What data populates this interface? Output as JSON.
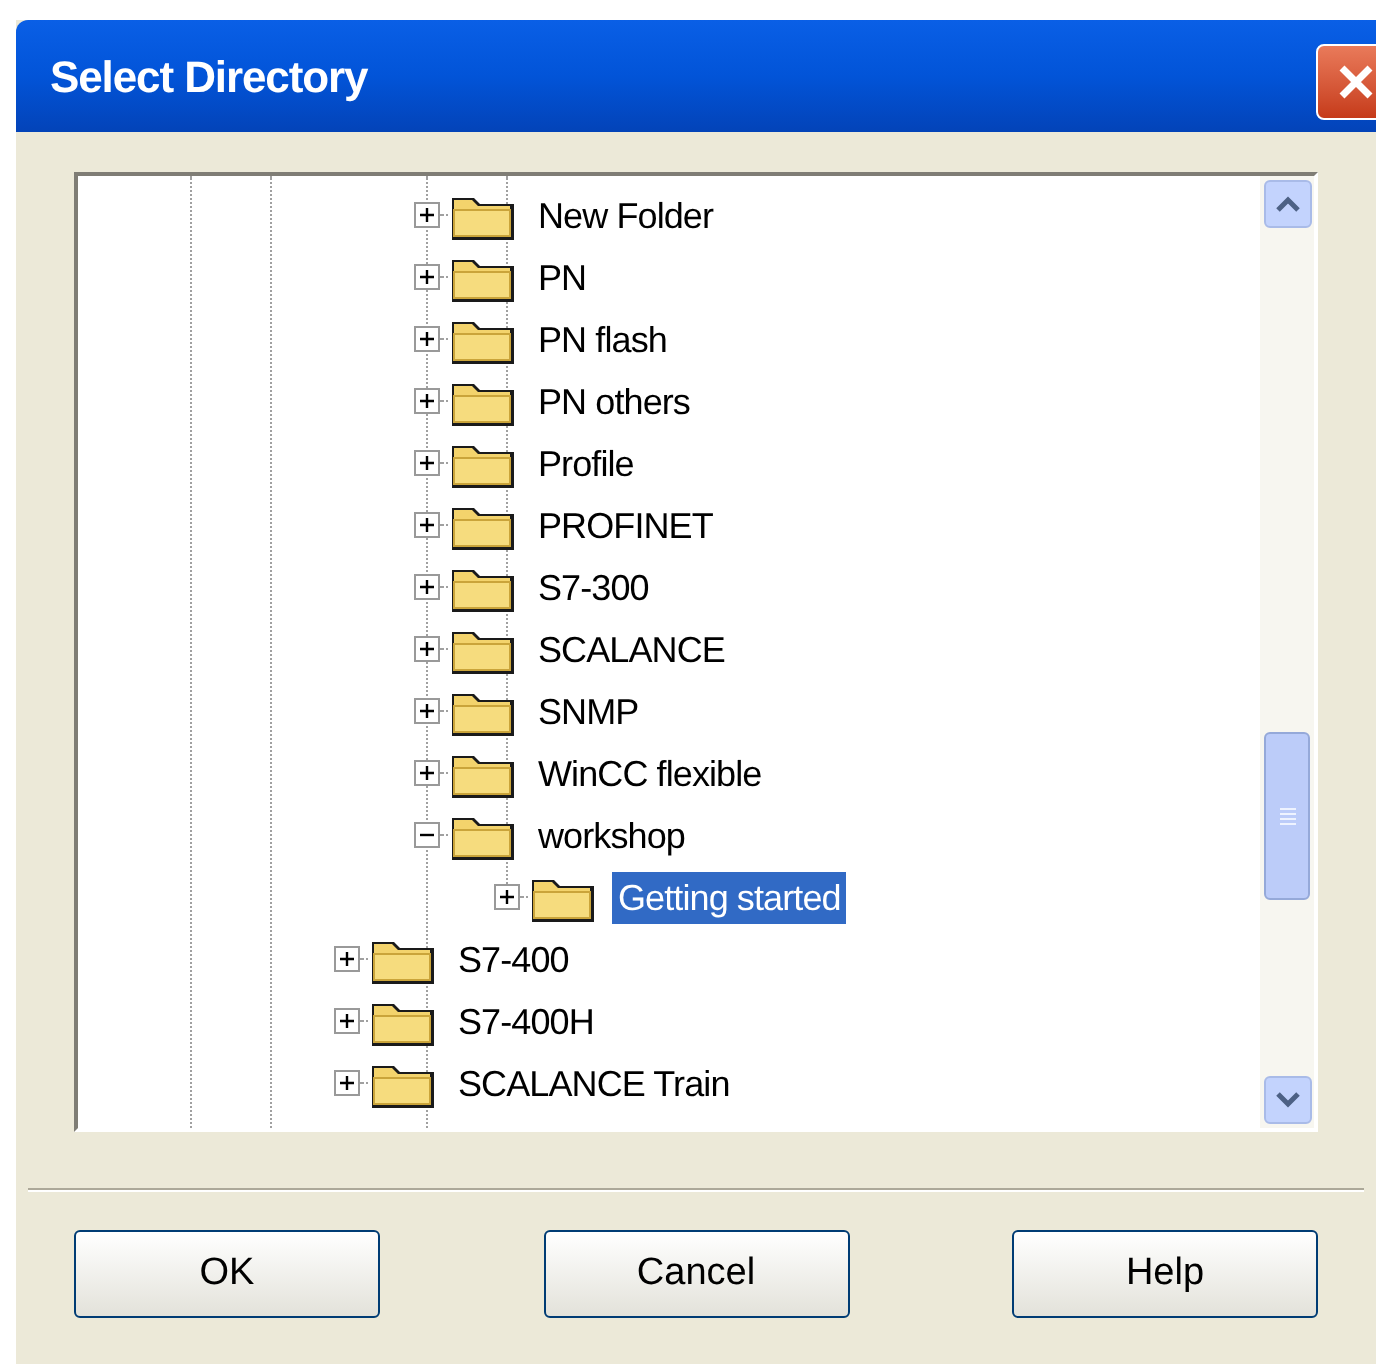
{
  "window": {
    "title": "Select Directory"
  },
  "tree": {
    "items": [
      {
        "children": [
          {
            "label": "New Folder",
            "expanded": false,
            "selected": false
          },
          {
            "label": "PN",
            "expanded": false,
            "selected": false
          },
          {
            "label": "PN flash",
            "expanded": false,
            "selected": false
          },
          {
            "label": "PN others",
            "expanded": false,
            "selected": false
          },
          {
            "label": "Profile",
            "expanded": false,
            "selected": false
          },
          {
            "label": "PROFINET",
            "expanded": false,
            "selected": false
          },
          {
            "label": "S7-300",
            "expanded": false,
            "selected": false
          },
          {
            "label": "SCALANCE",
            "expanded": false,
            "selected": false
          },
          {
            "label": "SNMP",
            "expanded": false,
            "selected": false
          },
          {
            "label": "WinCC flexible",
            "expanded": false,
            "selected": false
          },
          {
            "label": "workshop",
            "expanded": true,
            "selected": false,
            "children": [
              {
                "label": "Getting started",
                "expanded": false,
                "selected": true
              }
            ]
          }
        ]
      },
      {
        "label": "S7-400",
        "expanded": false,
        "selected": false
      },
      {
        "label": "S7-400H",
        "expanded": false,
        "selected": false
      },
      {
        "label": "SCALANCE Train",
        "expanded": false,
        "selected": false
      }
    ]
  },
  "buttons": [
    "OK",
    "Cancel",
    "Help"
  ]
}
